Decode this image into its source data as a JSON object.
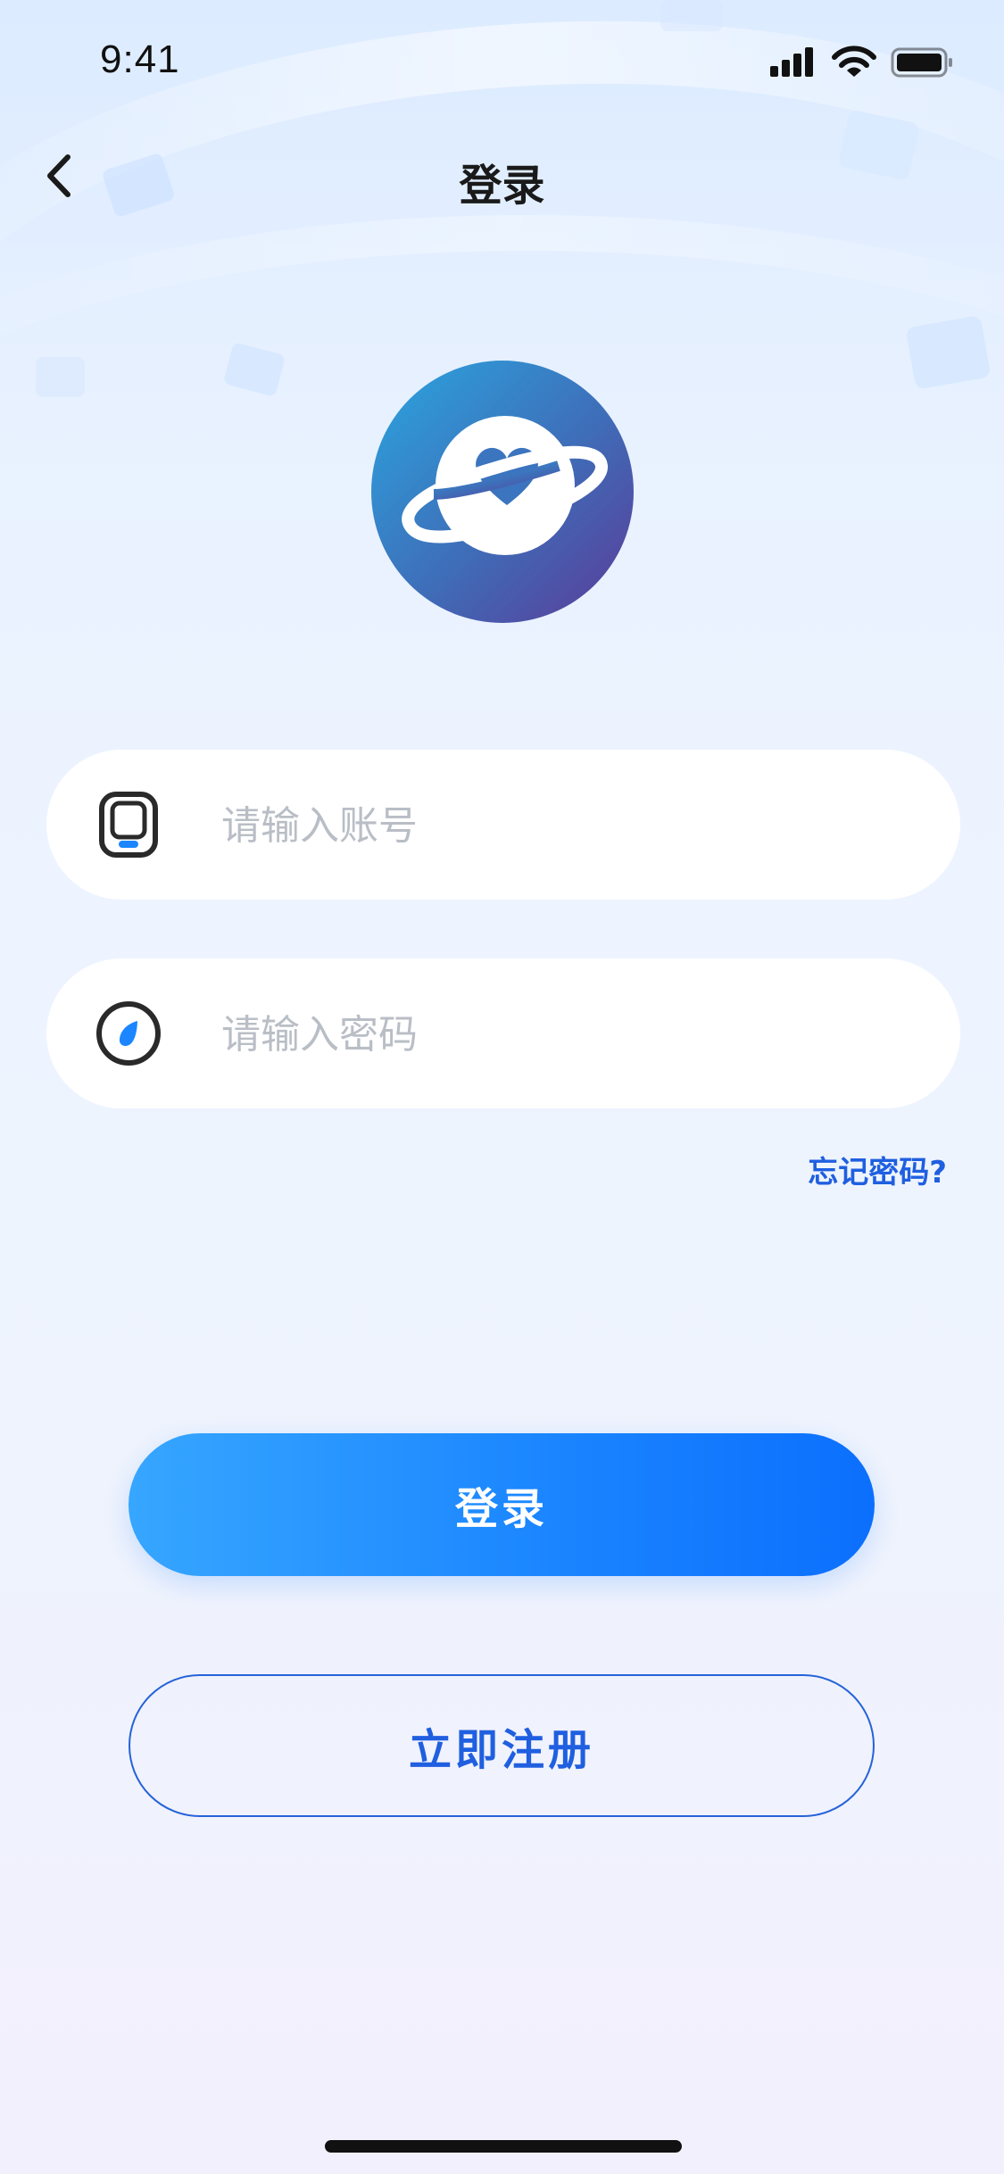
{
  "status_bar": {
    "time": "9:41",
    "icons": [
      "signal-icon",
      "wifi-icon",
      "battery-icon"
    ]
  },
  "nav": {
    "back_icon": "chevron-left-icon",
    "title": "登录"
  },
  "logo": {
    "icon": "planet-heart-icon",
    "gradient": [
      "#2d9bdc",
      "#5a3d9a"
    ]
  },
  "form": {
    "account": {
      "icon": "phone-icon",
      "placeholder": "请输入账号",
      "value": ""
    },
    "password": {
      "icon": "lock-dial-icon",
      "placeholder": "请输入密码",
      "value": ""
    },
    "forgot_label": "忘记密码?"
  },
  "actions": {
    "login_label": "登录",
    "register_label": "立即注册"
  },
  "colors": {
    "accent": "#1b86ff",
    "link": "#1f5fe0",
    "field_bg": "#ffffff"
  }
}
